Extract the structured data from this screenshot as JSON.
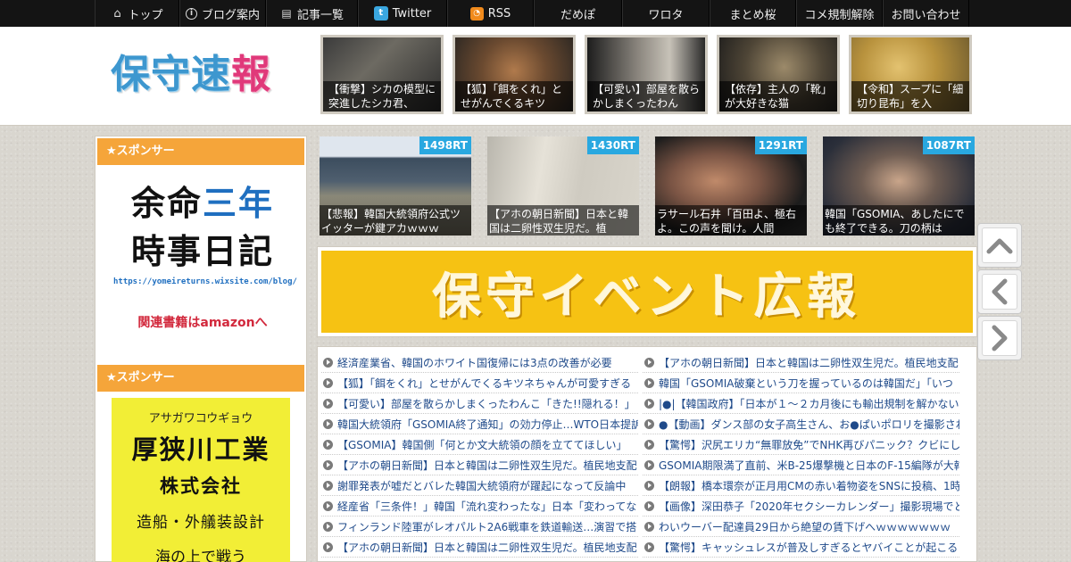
{
  "nav": {
    "items": [
      {
        "label": "トップ",
        "icon": "home-icon"
      },
      {
        "label": "ブログ案内",
        "icon": "info-icon"
      },
      {
        "label": "記事一覧",
        "icon": "list-icon"
      },
      {
        "label": "Twitter",
        "icon": "twitter-icon"
      },
      {
        "label": "RSS",
        "icon": "rss-icon"
      },
      {
        "label": "だめぽ"
      },
      {
        "label": "ワロタ"
      },
      {
        "label": "まとめ桜"
      },
      {
        "label": "コメ規制解除"
      },
      {
        "label": "お問い合わせ"
      }
    ]
  },
  "header": {
    "logo": {
      "part1": "保守速",
      "part2": "報"
    },
    "thumbs": [
      {
        "caption": "【衝撃】シカの模型に突進したシカ君、"
      },
      {
        "caption": "【狐】「餌をくれ」とせがんでくるキツ"
      },
      {
        "caption": "【可愛い】部屋を散らかしまくったわん"
      },
      {
        "caption": "【依存】主人の「靴」が大好きな猫"
      },
      {
        "caption": "【令和】スープに「細切り昆布」を入"
      }
    ]
  },
  "sidebar": {
    "sponsor_label": "★スポンサー",
    "ad1": {
      "line1_a": "余命",
      "line1_b": "三年",
      "line2": "時事日記",
      "url": "https://yomeireturns.wixsite.com/blog/",
      "amazon": "関連書籍はamazonへ"
    },
    "ad2": {
      "kana": "アサガワコウギョウ",
      "name": "厚狭川工業",
      "corp": "株式会社",
      "service": "造船・外艤装設計",
      "more": "海の上で戦う"
    }
  },
  "ranking": [
    {
      "rt": "1498RT",
      "caption": "【悲報】韓国大統領府公式ツイッターが鍵アカｗｗｗ"
    },
    {
      "rt": "1430RT",
      "caption": "【アホの朝日新聞】日本と韓国は二卵性双生児だ。植"
    },
    {
      "rt": "1291RT",
      "caption": "ラサール石井「百田よ、極右よ。この声を聞け。人間"
    },
    {
      "rt": "1087RT",
      "caption": "韓国「GSOMIA、あしたにでも終了できる。刀の柄は"
    }
  ],
  "banner": {
    "text": "保守イベント広報"
  },
  "side_buttons": [
    {
      "icon": "scroll-top-icon"
    },
    {
      "icon": "prev-icon"
    },
    {
      "icon": "next-icon"
    }
  ],
  "headlines": {
    "left": [
      "経済産業省、韓国のホワイト国復帰には3点の改善が必要",
      "【狐】「餌をくれ」とせがんでくるキツネちゃんが可愛すぎる",
      "【可愛い】部屋を散らかしまくったわんこ「きた!!隠れる！」",
      "韓国大統領府「GSOMIA終了通知」の効力停止…WTO日本提訴",
      "【GSOMIA】韓国側「何とか文大統領の顔を立ててほしい」",
      "【アホの朝日新聞】日本と韓国は二卵性双生児だ。植民地支配",
      "謝罪発表が嘘だとバレた韓国大統領府が躍起になって反論中",
      "経産省「三条件！」韓国「流れ変わったな」日本「変わってな",
      "フィンランド陸軍がレオパルト2A6戦車を鉄道輸送…演習で搭",
      "【アホの朝日新聞】日本と韓国は二卵性双生児だ。植民地支配"
    ],
    "right": [
      "【アホの朝日新聞】日本と韓国は二卵性双生児だ。植民地支配",
      "韓国「GSOMIA破棄という刀を握っているのは韓国だ」「いつ",
      "|●|【韓国政府】「日本が１～２カ月後にも輸出規制を解かない",
      "●【動画】ダンス部の女子高生さん、お●ぱいポロリを撮影され",
      "【驚愕】沢尻エリカ“無罪放免”でNHK再びパニック？クビにし",
      "GSOMIA期限満了直前、米B-25爆撃機と日本のF-15編隊が大韓",
      "【朗報】橋本環奈が正月用CMの赤い着物姿をSNSに投稿、1時",
      "【画像】深田恭子「2020年セクシーカレンダー」撮影現場でと",
      "わいウーバー配達員29日から絶望の賃下げへｗｗｗｗｗｗｗ",
      "【驚愕】キャッシュレスが普及しすぎるとヤバイことが起こる"
    ]
  },
  "colors": {
    "nav_bg": "#141414",
    "sponsor": "#f5a53a",
    "rt_badge": "#29a8e0",
    "banner": "#f6c213",
    "link": "#1f4a8a"
  }
}
